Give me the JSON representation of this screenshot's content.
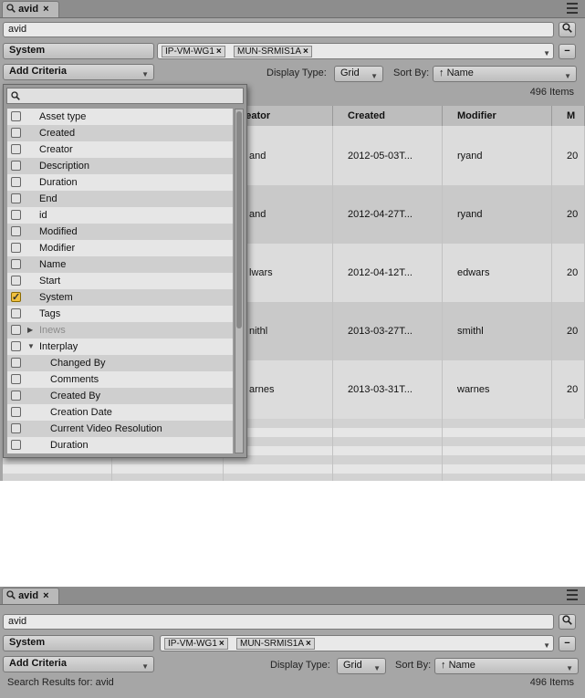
{
  "tab": {
    "title": "avid",
    "close": "×"
  },
  "search": {
    "value": "avid"
  },
  "system_button": "System",
  "chips": [
    {
      "label": "IP-VM-WG1",
      "x": "×"
    },
    {
      "label": "MUN-SRMIS1A",
      "x": "×"
    }
  ],
  "add_criteria": "Add Criteria",
  "display_type": {
    "label": "Display Type:",
    "value": "Grid"
  },
  "sort_by": {
    "label": "Sort By:",
    "value": "Name",
    "arrow": "↑"
  },
  "item_count": "496 Items",
  "search_results": "Search Results for: avid",
  "minus": "−",
  "grid": {
    "columns": [
      "reator",
      "Created",
      "Modifier",
      "M"
    ],
    "rows": [
      {
        "creator": "and",
        "created": "2012-05-03T...",
        "modifier": "ryand",
        "m": "20"
      },
      {
        "creator": "and",
        "created": "2012-04-27T...",
        "modifier": "ryand",
        "m": "20"
      },
      {
        "creator": "lwars",
        "created": "2012-04-12T...",
        "modifier": "edwars",
        "m": "20"
      },
      {
        "creator": "nithl",
        "created": "2013-03-27T...",
        "modifier": "smithl",
        "m": "20"
      },
      {
        "creator": "arnes",
        "created": "2013-03-31T...",
        "modifier": "warnes",
        "m": "20"
      }
    ]
  },
  "criteria": [
    {
      "label": "Asset type",
      "checked": false
    },
    {
      "label": "Created",
      "checked": false
    },
    {
      "label": "Creator",
      "checked": false
    },
    {
      "label": "Description",
      "checked": false
    },
    {
      "label": "Duration",
      "checked": false
    },
    {
      "label": "End",
      "checked": false
    },
    {
      "label": "id",
      "checked": false
    },
    {
      "label": "Modified",
      "checked": false
    },
    {
      "label": "Modifier",
      "checked": false
    },
    {
      "label": "Name",
      "checked": false
    },
    {
      "label": "Start",
      "checked": false
    },
    {
      "label": "System",
      "checked": true
    },
    {
      "label": "Tags",
      "checked": false
    },
    {
      "label": "Inews",
      "checked": false,
      "group": "collapsed",
      "disabled": true
    },
    {
      "label": "Interplay",
      "checked": false,
      "group": "expanded"
    },
    {
      "label": "Changed By",
      "checked": false,
      "indent": true
    },
    {
      "label": "Comments",
      "checked": false,
      "indent": true
    },
    {
      "label": "Created By",
      "checked": false,
      "indent": true
    },
    {
      "label": "Creation Date",
      "checked": false,
      "indent": true
    },
    {
      "label": "Current Video Resolution",
      "checked": false,
      "indent": true
    },
    {
      "label": "Duration",
      "checked": false,
      "indent": true
    }
  ],
  "colors": {
    "panel": "#a6a6a6",
    "accent": "#f0c040"
  }
}
